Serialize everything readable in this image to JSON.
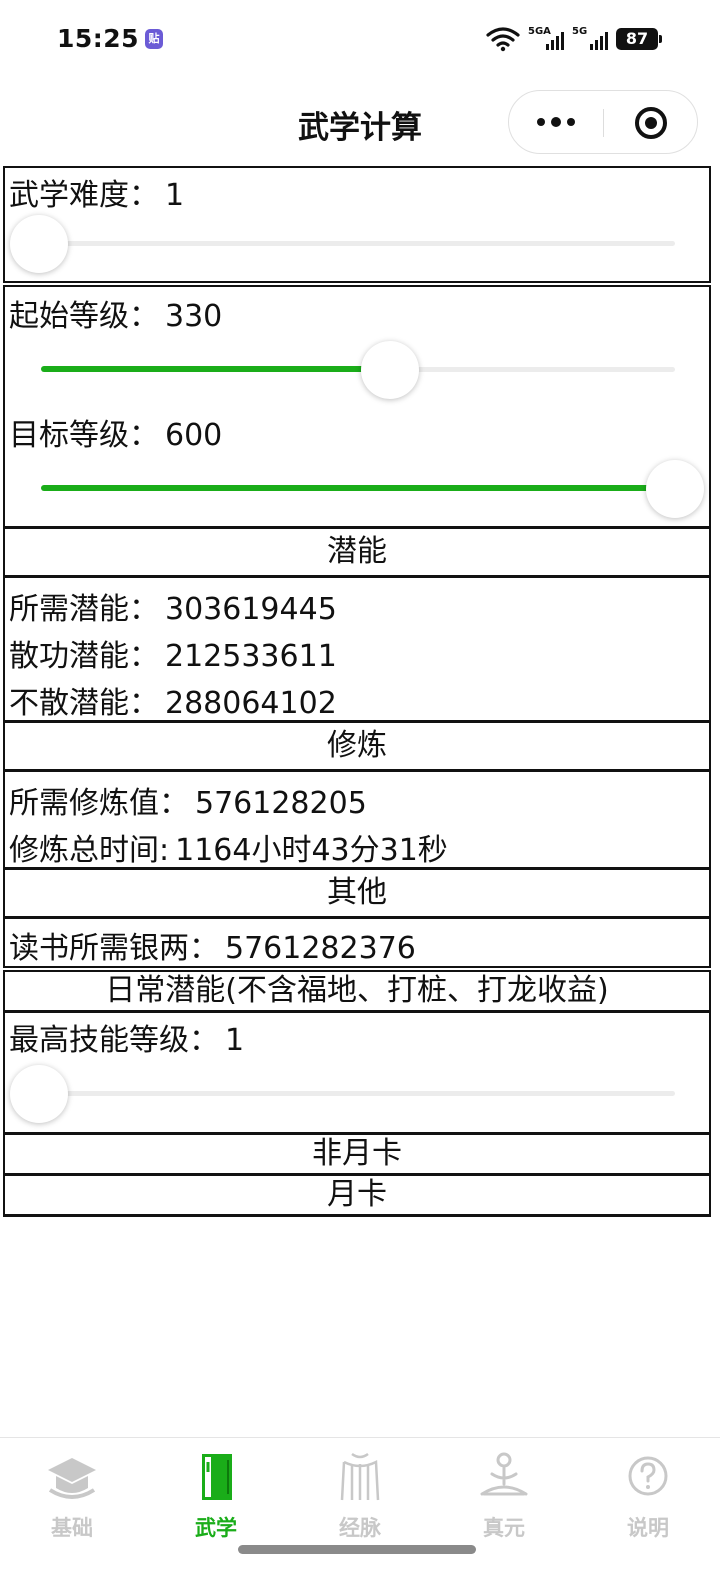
{
  "status_bar": {
    "time": "15:25",
    "app_badge": "贴",
    "signal1_label": "5GA",
    "signal2_label": "5G",
    "battery": "87"
  },
  "nav": {
    "title": "武学计算"
  },
  "difficulty": {
    "label": "武学难度：",
    "value": "1",
    "slider_fraction": 0.0
  },
  "levels": {
    "start_label": "起始等级：",
    "start_value": "330",
    "start_fraction": 0.55,
    "target_label": "目标等级：",
    "target_value": "600",
    "target_fraction": 1.0
  },
  "potential": {
    "header": "潜能",
    "required_label": "所需潜能：",
    "required_value": "303619445",
    "disperse_label": "散功潜能：",
    "disperse_value": "212533611",
    "no_disperse_label": "不散潜能：",
    "no_disperse_value": "288064102"
  },
  "cultivation": {
    "header": "修炼",
    "required_label": "所需修炼值：",
    "required_value": "576128205",
    "time_label": "修炼总时间:",
    "time_value": "1164小时43分31秒"
  },
  "other": {
    "header": "其他",
    "silver_label": "读书所需银两：",
    "silver_value": "5761282376"
  },
  "daily": {
    "header": "日常潜能(不含福地、打桩、打龙收益)",
    "max_skill_label": "最高技能等级：",
    "max_skill_value": "1",
    "slider_fraction": 0.0,
    "non_monthly": "非月卡",
    "monthly": "月卡"
  },
  "tabs": [
    {
      "label": "基础",
      "icon": "hat-icon",
      "active": false
    },
    {
      "label": "武学",
      "icon": "book-icon",
      "active": true
    },
    {
      "label": "经脉",
      "icon": "body-icon",
      "active": false
    },
    {
      "label": "真元",
      "icon": "meditation-icon",
      "active": false
    },
    {
      "label": "说明",
      "icon": "help-icon",
      "active": false
    }
  ],
  "colors": {
    "accent": "#1aad19",
    "inactive_tab": "#c8c8c8"
  }
}
